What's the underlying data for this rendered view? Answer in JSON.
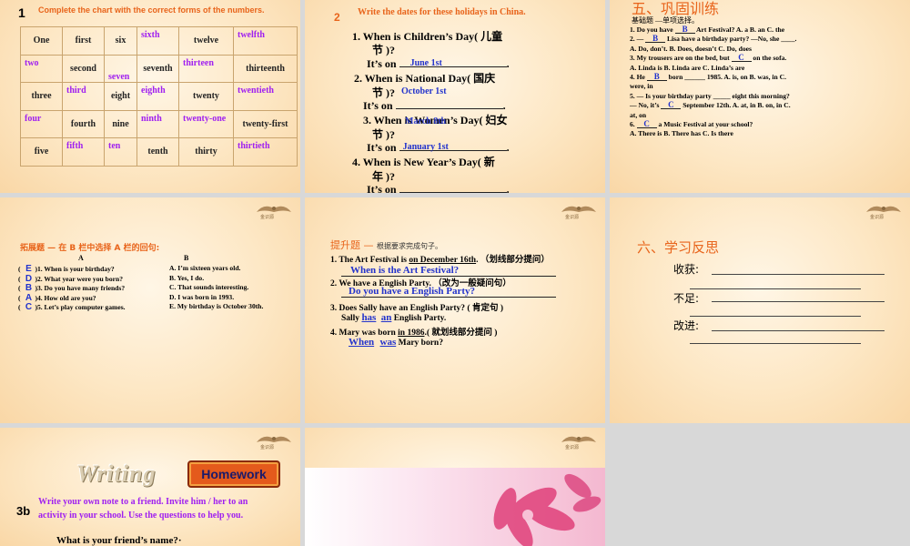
{
  "slide1": {
    "number": "1",
    "instruction": "Complete the chart with the correct forms of the numbers.",
    "rows": [
      [
        {
          "t": "One",
          "a": false
        },
        {
          "t": "first",
          "a": false
        },
        {
          "t": "six",
          "a": false
        },
        {
          "t": "sixth",
          "a": true
        },
        {
          "t": "twelve",
          "a": false
        },
        {
          "t": "twelfth",
          "a": true
        }
      ],
      [
        {
          "t": "two",
          "a": true
        },
        {
          "t": "second",
          "a": false
        },
        {
          "t": "seven",
          "a": true
        },
        {
          "t": "seventh",
          "a": false
        },
        {
          "t": "thirteen",
          "a": true
        },
        {
          "t": "thirteenth",
          "a": false
        }
      ],
      [
        {
          "t": "three",
          "a": false
        },
        {
          "t": "third",
          "a": true
        },
        {
          "t": "eight",
          "a": false
        },
        {
          "t": "eighth",
          "a": true
        },
        {
          "t": "twenty",
          "a": false
        },
        {
          "t": "twentieth",
          "a": true
        }
      ],
      [
        {
          "t": "four",
          "a": true
        },
        {
          "t": "fourth",
          "a": false
        },
        {
          "t": "nine",
          "a": false
        },
        {
          "t": "ninth",
          "a": true
        },
        {
          "t": "twenty-one",
          "a": true
        },
        {
          "t": "twenty-first",
          "a": false
        }
      ],
      [
        {
          "t": "five",
          "a": false
        },
        {
          "t": "fifth",
          "a": true
        },
        {
          "t": "ten",
          "a": true
        },
        {
          "t": "tenth",
          "a": false
        },
        {
          "t": "thirty",
          "a": false
        },
        {
          "t": "thirtieth",
          "a": true
        }
      ]
    ]
  },
  "slide2": {
    "number": "2",
    "instruction": "Write the dates for these holidays in China.",
    "q1": "1.  When is Children’s Day( 儿童",
    "q1b": "节 )?",
    "q1_prefix": "It’s on",
    "q1_answer": "June 1st",
    "q2": "2. When is National Day( 国庆",
    "q2b": "节 )?",
    "q2_answer": "October 1st",
    "q2_prefix": "It’s on",
    "q3": "3. When is Women’s Day( 妇女",
    "q3_overlay": "March 8th",
    "q3b": "节 )?",
    "q3_prefix": "It’s on",
    "q3_answer": "January 1st",
    "q4": "4. When is New Year’s  Day( 新",
    "q4b": "年 )?",
    "q4_prefix": "It’s on"
  },
  "slide3": {
    "title": "五、巩固训练",
    "subtitle": "基础题 —单项选择。",
    "lines": [
      {
        "pre": "1. Do you have ",
        "ans": "B",
        "post": "  Art Festival?     A. a    B. an              C. the"
      },
      {
        "pre": "2. — ",
        "ans": "B",
        "post": "  Lisa have a birthday party? —No, she ____."
      },
      {
        "pre": "   A. Do, don’t.   B. Does, doesn’t   C. Do, does",
        "ans": "",
        "post": ""
      },
      {
        "pre": "3. My trousers are on the bed, but ",
        "ans": "C",
        "post": " on the sofa."
      },
      {
        "pre": "   A. Linda is      B. Linda are      C. Linda’s are",
        "ans": "",
        "post": ""
      },
      {
        "pre": "4. He ",
        "ans": "B",
        "post": " born ______ 1985.     A. is, on          B. was, in    C."
      },
      {
        "pre": "were, in",
        "ans": "",
        "post": ""
      },
      {
        "pre": "5. — Is your birthday party _____ eight this morning?",
        "ans": "",
        "post": ""
      },
      {
        "pre": "   — No, it’s ",
        "ans": "C",
        "post": " September 12th.     A. at, in     B. on, in          C."
      },
      {
        "pre": "at, on",
        "ans": "",
        "post": ""
      },
      {
        "pre": "6. ",
        "ans": "C",
        "post": " a Music Festival at your school?"
      },
      {
        "pre": "   A. There is      B. There has     C. Is there",
        "ans": "",
        "post": ""
      }
    ]
  },
  "logo_text": "金识源",
  "slide4": {
    "title": "拓展题 — 在 B 栏中选择 A 栏的回句:",
    "colA": "A",
    "colB": "B",
    "answers": [
      "E",
      "D",
      "B",
      "A",
      "C"
    ],
    "questions": [
      {
        "q": "( ",
        "a": ")1. When is your birthday?",
        "b": "A. I’m sixteen years old."
      },
      {
        "q": "( ",
        "a": ")2. What year were you born?",
        "b": "B. Yes, I do."
      },
      {
        "q": "( ",
        "a": ")3. Do you have many friends?",
        "b": "C. That sounds interesting."
      },
      {
        "q": "( ",
        "a": ")4. How old are you?",
        "b": "D. I was born in 1993."
      },
      {
        "q": "( ",
        "a": ")5. Let’s play computer games.",
        "b": "E. My birthday is October 30th."
      }
    ]
  },
  "slide5": {
    "title": "提升题 —",
    "title_small": "根据要求完成句子。",
    "s1_pre": "1. The Art Festival is ",
    "s1_u": "on December 16th",
    "s1_post": ". （划线部分提问）",
    "s1_ans": "When is the Art Festival?",
    "s2": "2. We have a English Party. （改为一般疑问句）",
    "s2_ans": "Do you have a English Party?",
    "s3": "3. Does Sally have an English Party? ( 肯定句 )",
    "s3_a": "Sally ",
    "s3_has": "has",
    "s3_an": "an",
    "s3_post": " English Party.",
    "s4_pre": "4. Mary was born ",
    "s4_u": "in 1986",
    "s4_post": ".( 就划线部分提问 )",
    "s4_when": "When",
    "s4_was": "was",
    "s4_end": "Mary born?"
  },
  "slide6": {
    "title": "六、学习反思",
    "items": [
      "收获:",
      "不足:",
      "改进:"
    ]
  },
  "slide7": {
    "writing": "Writing",
    "homework": "Homework",
    "label": "3b",
    "instruction1": "Write your own note to a friend. Invite him / her to an",
    "instruction2": "activity in your school. Use the questions to help you.",
    "question": "What is your friend’s name?·"
  }
}
